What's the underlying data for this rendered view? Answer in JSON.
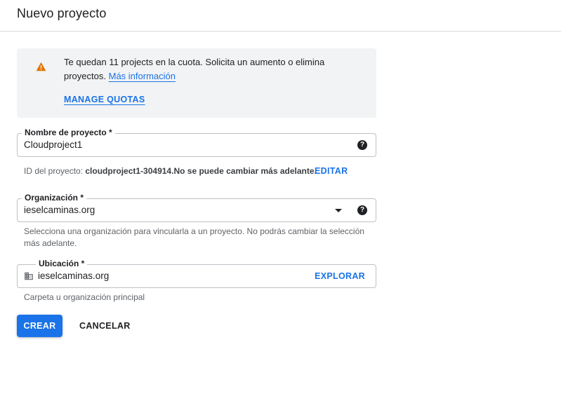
{
  "header": {
    "title": "Nuevo proyecto"
  },
  "quota": {
    "message": "Te quedan 11 projects en la cuota. Solicita un aumento o elimina proyectos.",
    "more_info_link": "Más información",
    "manage_link": "MANAGE QUOTAS",
    "icon": "warning-icon",
    "icon_color": "#e37400"
  },
  "project_name": {
    "label": "Nombre de proyecto *",
    "value": "Cloudproject1",
    "help_icon": "help-icon"
  },
  "project_id": {
    "prefix": "ID del proyecto: ",
    "id": "cloudproject1-304914.",
    "suffix": "No se puede cambiar más adelante.",
    "edit_label": "EDITAR"
  },
  "organization": {
    "label": "Organización *",
    "value": "ieselcaminas.org",
    "hint": "Selecciona una organización para vincularla a un proyecto. No podrás cambiar la selección más adelante."
  },
  "location": {
    "label": "Ubicación *",
    "value": "ieselcaminas.org",
    "explore_label": "EXPLORAR",
    "hint": "Carpeta u organización principal",
    "icon": "building-icon"
  },
  "actions": {
    "create_label": "CREAR",
    "cancel_label": "CANCELAR"
  },
  "colors": {
    "accent": "#1a73e8",
    "banner_bg": "#f1f3f4",
    "border": "#bdc1c6"
  }
}
